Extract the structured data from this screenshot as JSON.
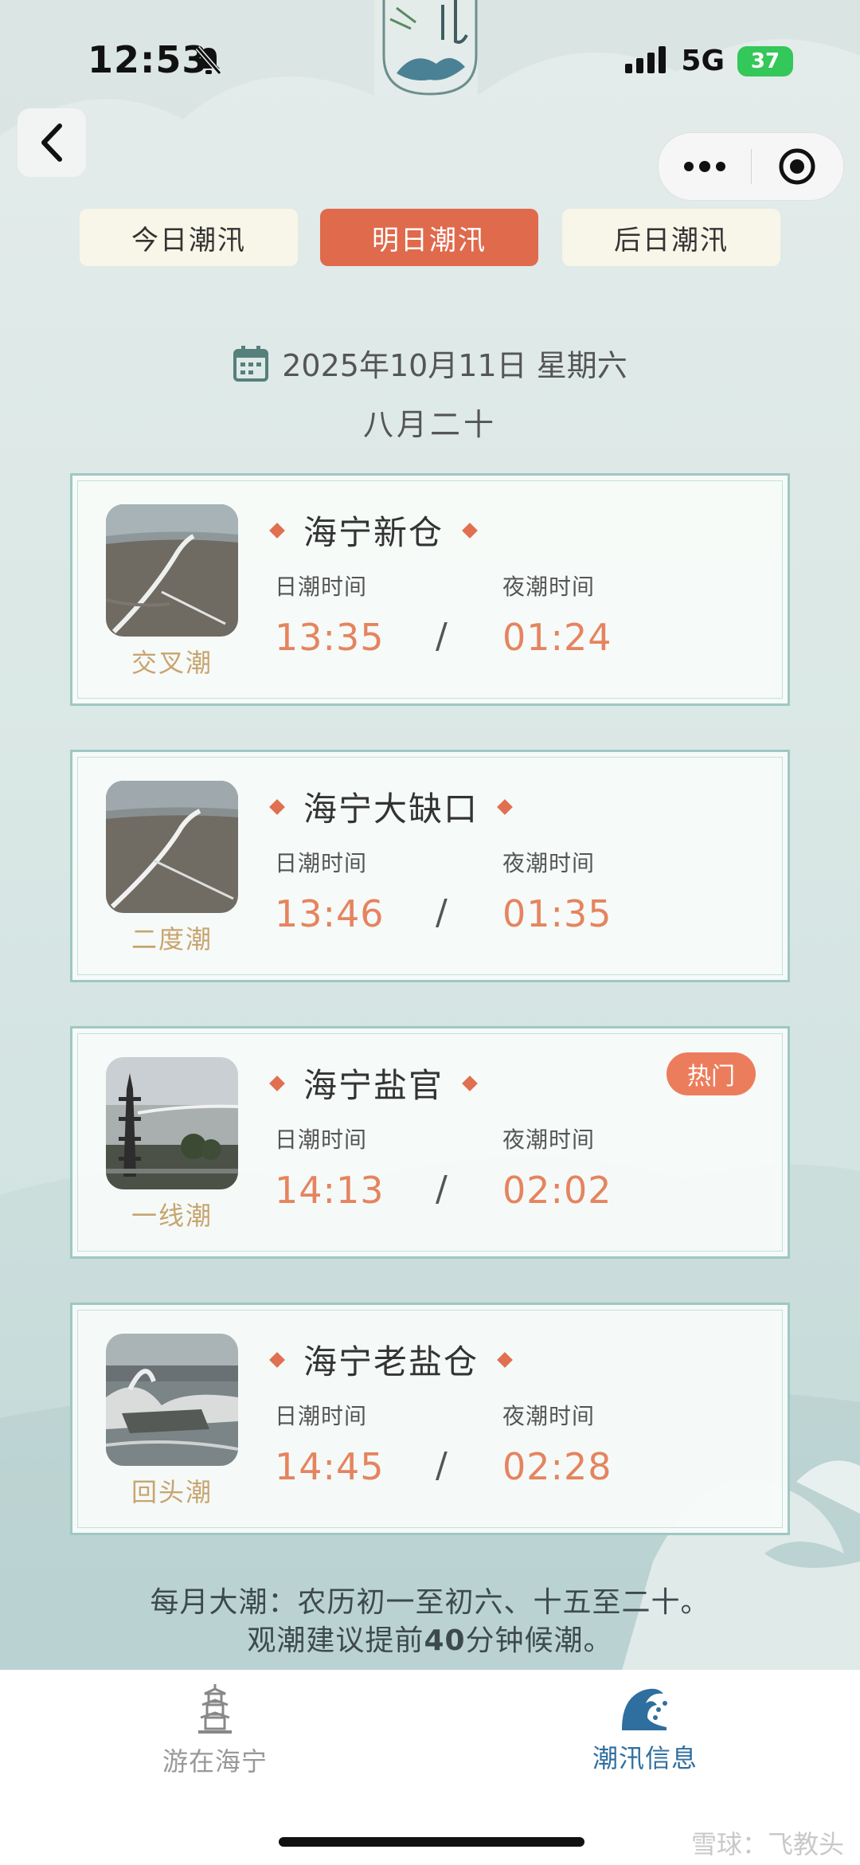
{
  "status_bar": {
    "time": "12:53",
    "network": "5G",
    "battery": "37",
    "icons": [
      "bell-mute-icon",
      "signal-icon",
      "battery-icon"
    ]
  },
  "nav": {
    "back_icon": "chevron-left-icon",
    "menu_icon": "more-dots-icon",
    "target_icon": "target-icon"
  },
  "tabs": [
    {
      "label": "今日潮汛",
      "active": false
    },
    {
      "label": "明日潮汛",
      "active": true
    },
    {
      "label": "后日潮汛",
      "active": false
    }
  ],
  "date": {
    "text": "2025年10月11日 星期六",
    "lunar": "八月二十",
    "icon": "calendar-icon"
  },
  "labels": {
    "day": "日潮时间",
    "night": "夜潮时间",
    "separator": "/"
  },
  "spots": [
    {
      "name": "海宁新仓",
      "type": "交叉潮",
      "day_time": "13:35",
      "night_time": "01:24",
      "badge": ""
    },
    {
      "name": "海宁大缺口",
      "type": "二度潮",
      "day_time": "13:46",
      "night_time": "01:35",
      "badge": ""
    },
    {
      "name": "海宁盐官",
      "type": "一线潮",
      "day_time": "14:13",
      "night_time": "02:02",
      "badge": "热门"
    },
    {
      "name": "海宁老盐仓",
      "type": "回头潮",
      "day_time": "14:45",
      "night_time": "02:28",
      "badge": ""
    }
  ],
  "note": {
    "line1": "每月大潮：农历初一至初六、十五至二十。",
    "line2_pre": "观潮建议提前",
    "line2_bold": "40",
    "line2_post": "分钟候潮。"
  },
  "tabbar": [
    {
      "label": "游在海宁",
      "icon": "pagoda-icon",
      "active": false
    },
    {
      "label": "潮汛信息",
      "icon": "wave-icon",
      "active": true
    }
  ],
  "watermark": "雪球：飞教头",
  "colors": {
    "accent": "#df6a4c",
    "time_value": "#e5845f",
    "tide_type": "#c8a46f",
    "active_tab_label": "#2f6f9f",
    "inactive_tab_label": "#999999"
  }
}
